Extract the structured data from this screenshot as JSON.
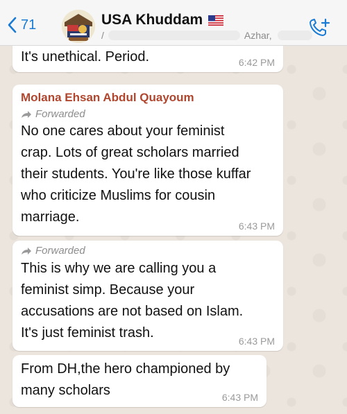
{
  "header": {
    "back_count": "71",
    "group_name": "USA Khuddam",
    "flag": "🇺🇸",
    "subtitle_prefix": "/",
    "subtitle_name": "Azhar,"
  },
  "messages": [
    {
      "text": "It's unethical. Period.",
      "time": "6:42 PM"
    },
    {
      "sender": "Molana Ehsan Abdul Quayoum",
      "forwarded": "Forwarded",
      "lines": [
        "No one cares about your feminist",
        "crap. Lots of great scholars married",
        "their students. You're like those kuffar",
        "who criticize Muslims for cousin",
        "marriage."
      ],
      "time": "6:43 PM"
    },
    {
      "forwarded": "Forwarded",
      "lines": [
        "This is why we are calling you a",
        "feminist simp. Because your",
        "accusations are not based on Islam.",
        "It's just feminist trash."
      ],
      "time": "6:43 PM"
    },
    {
      "lines": [
        "From DH,the hero championed by",
        "many scholars"
      ],
      "time": "6:43 PM"
    }
  ],
  "colors": {
    "header_bg": "#F6F6F6",
    "chat_bg": "#ECE5DD",
    "accent_blue": "#1a7bd4",
    "sender_color": "#b0462e",
    "bubble_bg": "#ffffff"
  },
  "icons": [
    "chevron-left-icon",
    "group-avatar",
    "us-flag-icon",
    "add-call-icon",
    "forward-arrow-icon"
  ]
}
